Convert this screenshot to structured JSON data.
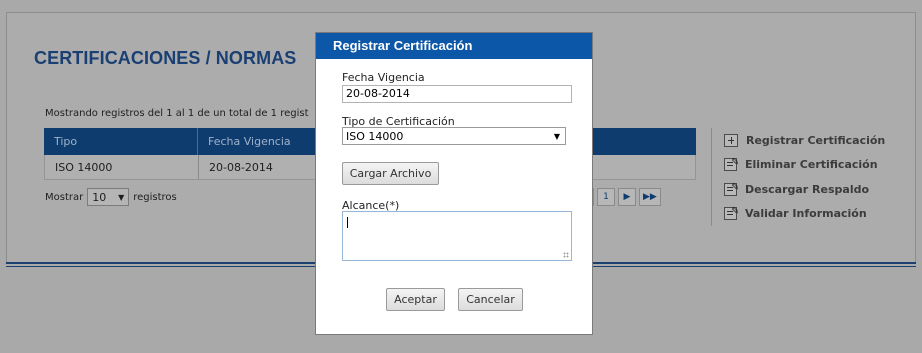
{
  "background": {
    "page_title": "CERTIFICACIONES / NORMAS",
    "records_info": "Mostrando registros del 1 al 1 de un total de 1 regist",
    "table": {
      "columns": [
        "Tipo",
        "Fecha Vigencia"
      ],
      "rows": [
        [
          "ISO 14000",
          "20-08-2014"
        ]
      ]
    },
    "show": {
      "prefix": "Mostrar",
      "value": "10",
      "suffix": "registros"
    },
    "pager": {
      "prev": "◀",
      "page": "1",
      "next": "▶",
      "last": "▶▶"
    },
    "actions": [
      {
        "label": "Registrar Certificación",
        "icon": "add-icon"
      },
      {
        "label": "Eliminar Certificación",
        "icon": "edit-doc-icon"
      },
      {
        "label": "Descargar Respaldo",
        "icon": "edit-doc-icon"
      },
      {
        "label": "Validar Información",
        "icon": "edit-doc-icon"
      }
    ]
  },
  "modal": {
    "title": "Registrar Certificación",
    "fecha_label": "Fecha Vigencia",
    "fecha_value": "20-08-2014",
    "tipo_label": "Tipo de Certificación",
    "tipo_value": "ISO 14000",
    "cargar_label": "Cargar Archivo",
    "alcance_label": "Alcance(*)",
    "alcance_value": "",
    "aceptar_label": "Aceptar",
    "cancelar_label": "Cancelar"
  },
  "colors": {
    "modal_header": "#0d57a8",
    "table_header": "#0f3c6e",
    "title": "#1a3f73"
  }
}
